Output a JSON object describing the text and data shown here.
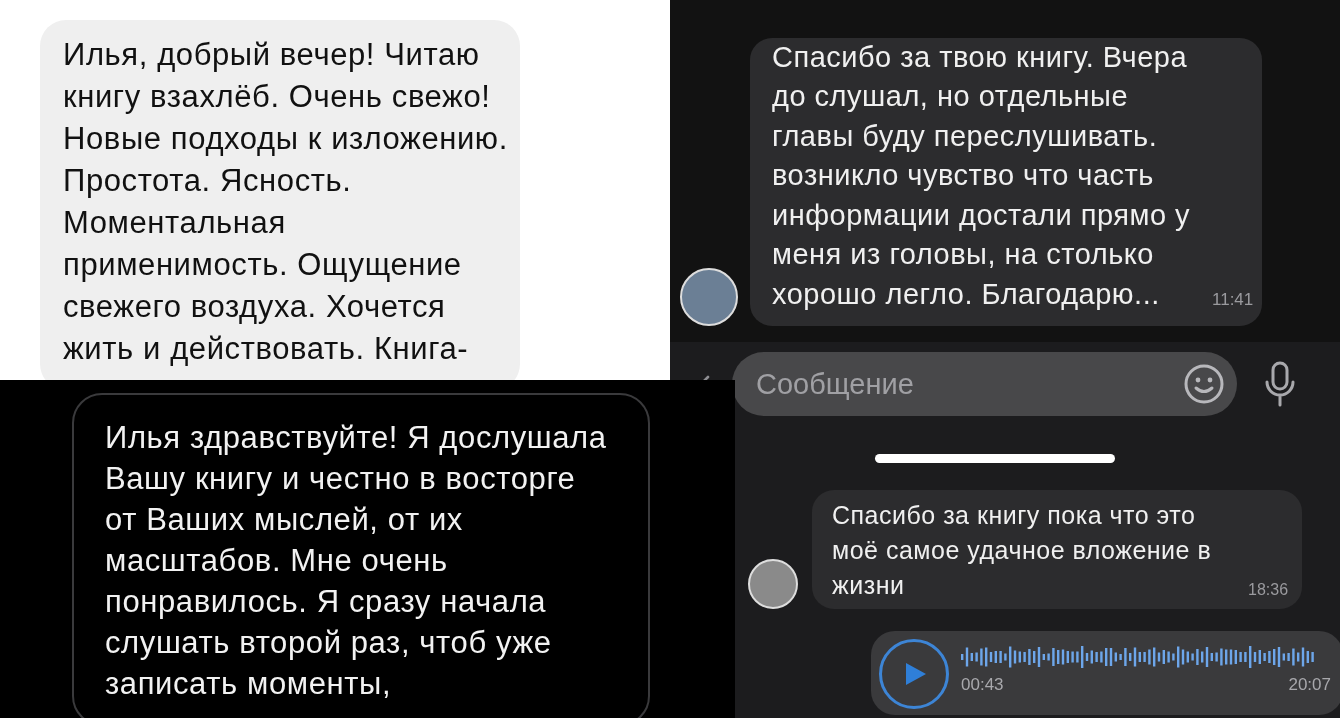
{
  "light_chat": {
    "messages": [
      {
        "text": "Илья, добрый вечер! Читаю книгу взахлёб. Очень свежо! Новые подходы к изложению. Простота. Ясность. Моментальная применимость. Ощущение свежего воздуха. Хочется жить и действовать. Книга-"
      }
    ]
  },
  "dark_chat": {
    "messages": [
      {
        "text": "Спасибо за твою книгу. Вчера до слушал, но отдельные главы буду переслушивать. возникло чувство что часть информации достали прямо у меня из головы, на столько хорошо легло. Благодарю...",
        "time": "11:41"
      }
    ],
    "input": {
      "placeholder": "Сообщение"
    }
  },
  "black_chat": {
    "messages": [
      {
        "text": "Илья здравствуйте! Я дослушала Вашу книгу и честно в восторге от Ваших мыслей, от их масштабов. Мне очень понравилось. Я сразу начала слушать второй раз, чтоб уже записать моменты,"
      }
    ]
  },
  "dark_chat_2": {
    "messages": [
      {
        "kind": "text",
        "text": "Спасибо за книгу пока что это моё самое удачное вложение в жизни",
        "time": "18:36"
      },
      {
        "kind": "voice",
        "duration": "00:43",
        "time": "20:07"
      }
    ]
  }
}
